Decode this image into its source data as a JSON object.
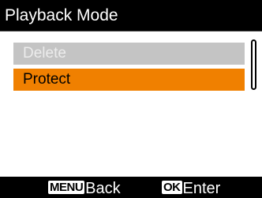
{
  "title": "Playback Mode",
  "menu": {
    "items": [
      {
        "label": "Delete",
        "state": "disabled"
      },
      {
        "label": "Protect",
        "state": "selected"
      }
    ]
  },
  "footer": {
    "back_key": "MENU",
    "back_label": "Back",
    "enter_key": "OK",
    "enter_label": "Enter"
  },
  "colors": {
    "title_bg": "#000000",
    "content_bg": "#ffffff",
    "selected_bg": "#f08000",
    "disabled_bg": "#c4c4c4",
    "disabled_text": "#ececec"
  }
}
